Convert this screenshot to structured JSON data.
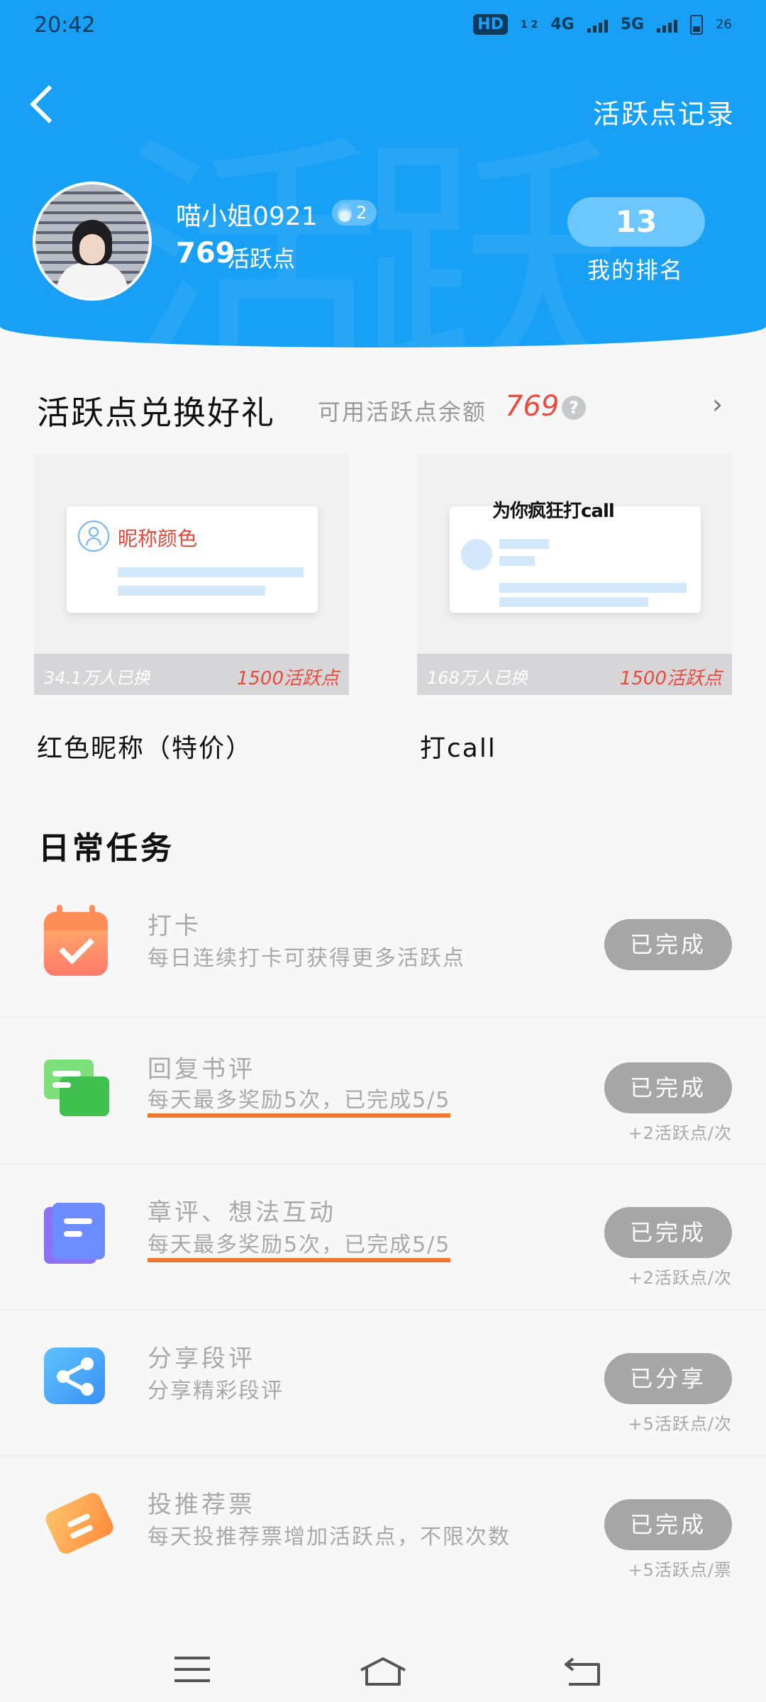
{
  "status_bar": {
    "time": "20:42",
    "hd": "HD",
    "hd_sub": "1 2",
    "net1": "4G",
    "net2": "5G",
    "battery": "26"
  },
  "header": {
    "back_icon": "chevron-left-icon",
    "records_link": "活跃点记录",
    "username": "喵小姐0921",
    "level": "2",
    "points_value": "769",
    "points_unit": "活跃点",
    "rank_value": "13",
    "rank_label": "我的排名",
    "watermark": "活跃"
  },
  "exchange": {
    "title": "活跃点兑换好礼",
    "balance_label": "可用活跃点余额",
    "balance_value": "769",
    "help_icon": "?",
    "chevron": "›",
    "items": [
      {
        "preview_text": "昵称颜色",
        "count": "34.1万人已换",
        "price": "1500活跃点",
        "name": "红色昵称（特价）"
      },
      {
        "preview_text": "为你疯狂打call",
        "count": "168万人已换",
        "price": "1500活跃点",
        "name": "打call"
      }
    ]
  },
  "tasks": {
    "title": "日常任务",
    "items": [
      {
        "icon": "calendar-check-icon",
        "name": "打卡",
        "desc": "每日连续打卡可获得更多活跃点",
        "button": "已完成",
        "reward": ""
      },
      {
        "icon": "chat-bubbles-icon",
        "name": "回复书评",
        "desc": "每天最多奖励5次，已完成5/5",
        "button": "已完成",
        "reward": "+2活跃点/次"
      },
      {
        "icon": "document-stack-icon",
        "name": "章评、想法互动",
        "desc": "每天最多奖励5次，已完成5/5",
        "button": "已完成",
        "reward": "+2活跃点/次"
      },
      {
        "icon": "share-icon",
        "name": "分享段评",
        "desc": "分享精彩段评",
        "button": "已分享",
        "reward": "+5活跃点/次"
      },
      {
        "icon": "ticket-icon",
        "name": "投推荐票",
        "desc": "每天投推荐票增加活跃点，不限次数",
        "button": "已完成",
        "reward": "+5活跃点/票"
      }
    ]
  },
  "navbar": {
    "menu_icon": "menu-icon",
    "home_icon": "home-icon",
    "back_icon": "back-icon"
  }
}
